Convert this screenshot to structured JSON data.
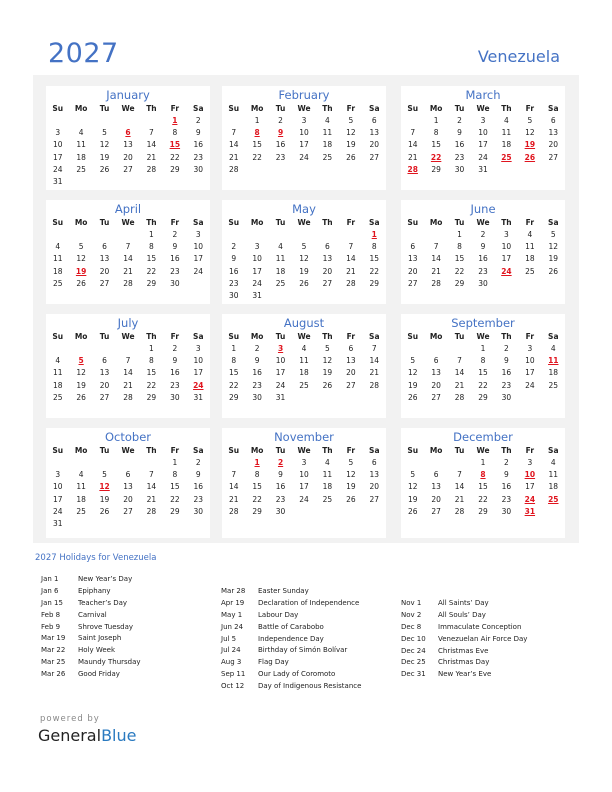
{
  "header": {
    "year": "2027",
    "country": "Venezuela"
  },
  "weekday_labels": [
    "Su",
    "Mo",
    "Tu",
    "We",
    "Th",
    "Fr",
    "Sa"
  ],
  "colors": {
    "accent": "#4472c4",
    "holiday": "#e0141e",
    "panel_bg": "#f2f2f2"
  },
  "months": [
    {
      "name": "January",
      "first_weekday": 5,
      "days": 31,
      "holidays": [
        1,
        6,
        15
      ]
    },
    {
      "name": "February",
      "first_weekday": 1,
      "days": 28,
      "holidays": [
        8,
        9
      ]
    },
    {
      "name": "March",
      "first_weekday": 1,
      "days": 31,
      "holidays": [
        19,
        22,
        25,
        26,
        28
      ]
    },
    {
      "name": "April",
      "first_weekday": 4,
      "days": 30,
      "holidays": [
        19
      ]
    },
    {
      "name": "May",
      "first_weekday": 6,
      "days": 31,
      "holidays": [
        1
      ]
    },
    {
      "name": "June",
      "first_weekday": 2,
      "days": 30,
      "holidays": [
        24
      ]
    },
    {
      "name": "July",
      "first_weekday": 4,
      "days": 31,
      "holidays": [
        5,
        24
      ]
    },
    {
      "name": "August",
      "first_weekday": 0,
      "days": 31,
      "holidays": [
        3
      ]
    },
    {
      "name": "September",
      "first_weekday": 3,
      "days": 30,
      "holidays": [
        11
      ]
    },
    {
      "name": "October",
      "first_weekday": 5,
      "days": 31,
      "holidays": [
        12
      ]
    },
    {
      "name": "November",
      "first_weekday": 1,
      "days": 30,
      "holidays": [
        1,
        2
      ]
    },
    {
      "name": "December",
      "first_weekday": 3,
      "days": 31,
      "holidays": [
        8,
        10,
        24,
        25,
        31
      ]
    }
  ],
  "holidays_section": {
    "title": "2027 Holidays for Venezuela",
    "columns": [
      [
        {
          "date": "Jan 1",
          "name": "New Year’s Day"
        },
        {
          "date": "Jan 6",
          "name": "Epiphany"
        },
        {
          "date": "Jan 15",
          "name": "Teacher’s Day"
        },
        {
          "date": "Feb 8",
          "name": "Carnival"
        },
        {
          "date": "Feb 9",
          "name": "Shrove Tuesday"
        },
        {
          "date": "Mar 19",
          "name": "Saint Joseph"
        },
        {
          "date": "Mar 22",
          "name": "Holy Week"
        },
        {
          "date": "Mar 25",
          "name": "Maundy Thursday"
        },
        {
          "date": "Mar 26",
          "name": "Good Friday"
        }
      ],
      [
        {
          "date": "Mar 28",
          "name": "Easter Sunday"
        },
        {
          "date": "Apr 19",
          "name": "Declaration of Independence"
        },
        {
          "date": "May 1",
          "name": "Labour Day"
        },
        {
          "date": "Jun 24",
          "name": "Battle of Carabobo"
        },
        {
          "date": "Jul 5",
          "name": "Independence Day"
        },
        {
          "date": "Jul 24",
          "name": "Birthday of Simón Bolívar"
        },
        {
          "date": "Aug 3",
          "name": "Flag Day"
        },
        {
          "date": "Sep 11",
          "name": "Our Lady of Coromoto"
        },
        {
          "date": "Oct 12",
          "name": "Day of Indigenous Resistance"
        }
      ],
      [
        {
          "date": "Nov 1",
          "name": "All Saints’ Day"
        },
        {
          "date": "Nov 2",
          "name": "All Souls’ Day"
        },
        {
          "date": "Dec 8",
          "name": "Immaculate Conception"
        },
        {
          "date": "Dec 10",
          "name": "Venezuelan Air Force Day"
        },
        {
          "date": "Dec 24",
          "name": "Christmas Eve"
        },
        {
          "date": "Dec 25",
          "name": "Christmas Day"
        },
        {
          "date": "Dec 31",
          "name": "New Year’s Eve"
        }
      ]
    ]
  },
  "footer": {
    "powered_by": "powered by",
    "brand_general": "General",
    "brand_blue": "Blue"
  }
}
